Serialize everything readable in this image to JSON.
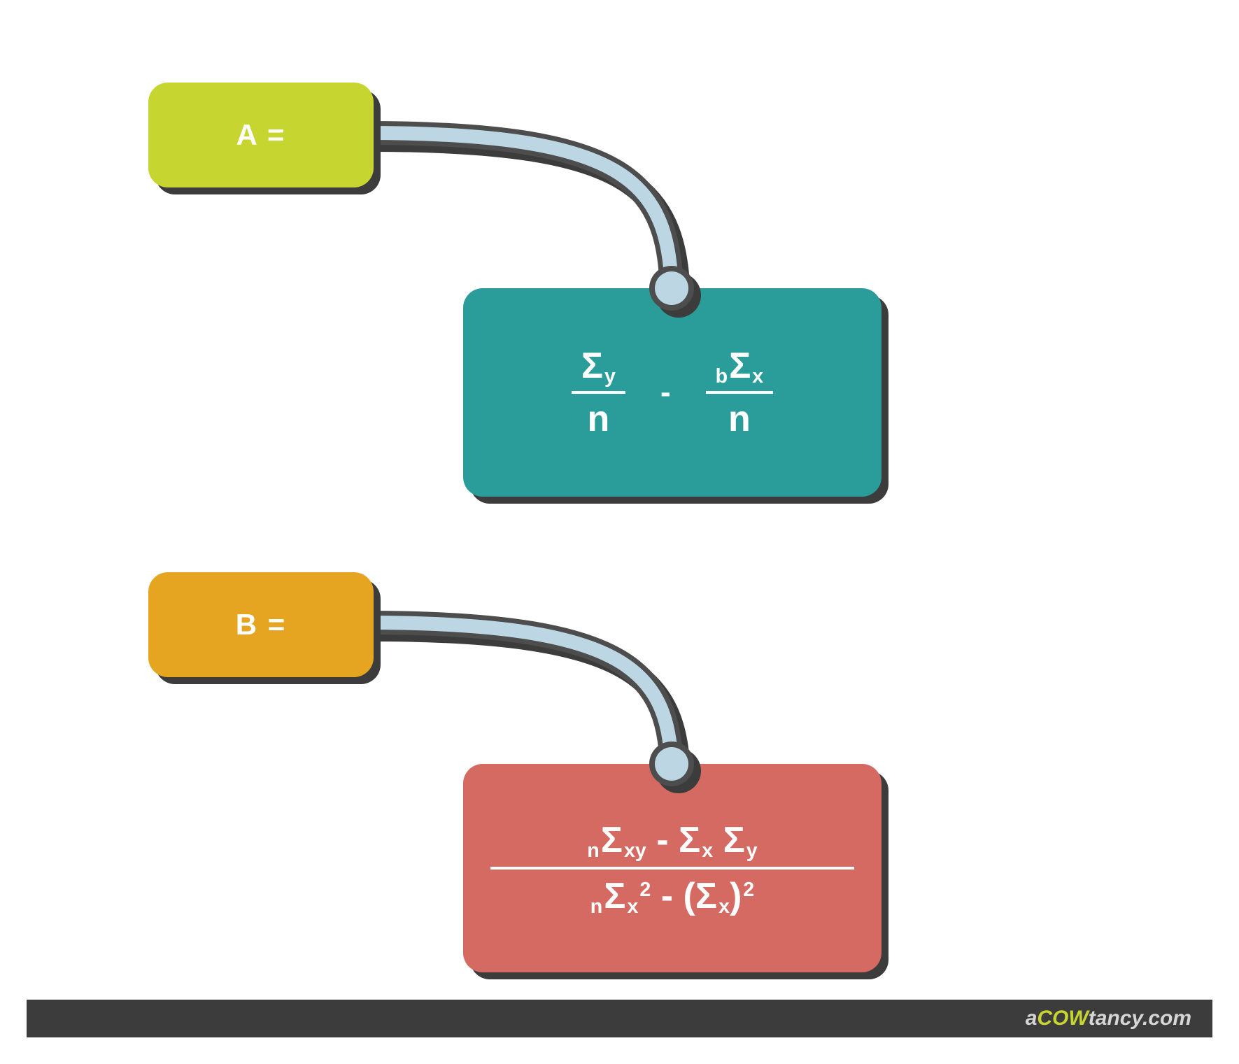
{
  "labels": {
    "a": "A =",
    "b": "B ="
  },
  "formulaA": {
    "frac1_num_sigma": "Σ",
    "frac1_num_sub": "y",
    "frac1_den": "n",
    "minus": "-",
    "frac2_num_pre": "b",
    "frac2_num_sigma": "Σ",
    "frac2_num_sub": "x",
    "frac2_den": "n"
  },
  "formulaB": {
    "num_pre1": "n",
    "num_sigma1": "Σ",
    "num_sub1": "xy",
    "num_minus": " - ",
    "num_sigma2": "Σ",
    "num_sub2": "x",
    "num_space": " ",
    "num_sigma3": "Σ",
    "num_sub3": "y",
    "den_pre1": "n",
    "den_sigma1": "Σ",
    "den_sub1": "x",
    "den_sup1": "2",
    "den_minus": "  -  ",
    "den_lpar": "(",
    "den_sigma2": "Σ",
    "den_sub2": "x",
    "den_rpar": ")",
    "den_sup2": "2"
  },
  "footer": {
    "part1": "a",
    "part2": "COW",
    "part3": "tancy.com"
  },
  "colors": {
    "green": "#c7d530",
    "teal": "#2a9d9a",
    "orange": "#e6a521",
    "red": "#d46a61",
    "dark": "#3c3c3c",
    "connector_fill": "#bcd7e3",
    "connector_stroke": "#4d4d4d"
  }
}
